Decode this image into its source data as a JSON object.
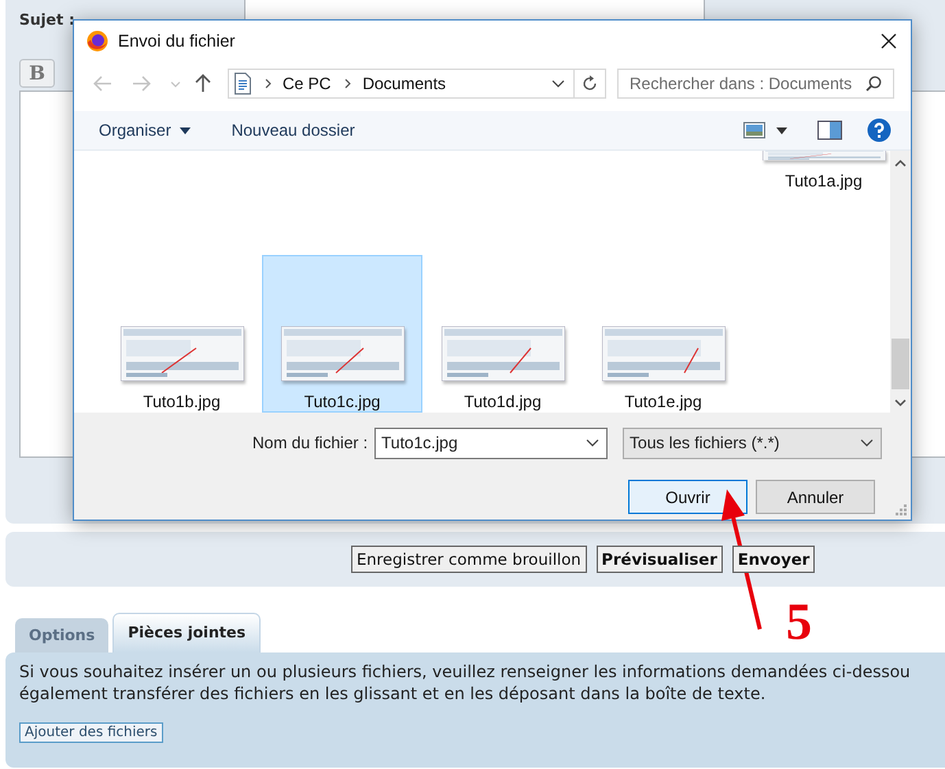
{
  "post_form": {
    "subject_label": "Sujet :",
    "format_buttons": [
      "B"
    ]
  },
  "submit_buttons": [
    {
      "label": "Enregistrer comme brouillon",
      "bold": false
    },
    {
      "label": "Prévisualiser",
      "bold": true
    },
    {
      "label": "Envoyer",
      "bold": true
    }
  ],
  "tabs": [
    {
      "label": "Options",
      "selected": false
    },
    {
      "label": "Pièces jointes",
      "selected": true
    }
  ],
  "attachments": {
    "text": "Si vous souhaitez insérer un ou plusieurs fichiers, veuillez renseigner les informations demandées ci-dessou",
    "text_2": "également transférer des fichiers en les glissant et en les déposant dans la boîte de texte.",
    "button": "Ajouter des fichiers"
  },
  "dialog": {
    "title": "Envoi du fichier",
    "path": [
      "Ce PC",
      "Documents"
    ],
    "search": {
      "placeholder": "Rechercher dans : Documents"
    },
    "toolbar": [
      "Organiser",
      "Nouveau dossier"
    ],
    "files": [
      {
        "name": "Tuto1a.jpg",
        "selected": false
      },
      {
        "name": "Tuto1b.jpg",
        "selected": false
      },
      {
        "name": "Tuto1c.jpg",
        "selected": true
      },
      {
        "name": "Tuto1d.jpg",
        "selected": false
      },
      {
        "name": "Tuto1e.jpg",
        "selected": false
      }
    ],
    "filename_label": "Nom du fichier :",
    "filename": "Tuto1c.jpg",
    "file_type": "Tous les fichiers (*.*)",
    "buttons": [
      {
        "label": "Ouvrir",
        "focused": true
      },
      {
        "label": "Annuler",
        "focused": false
      }
    ]
  },
  "annotation": {
    "label": "5"
  }
}
